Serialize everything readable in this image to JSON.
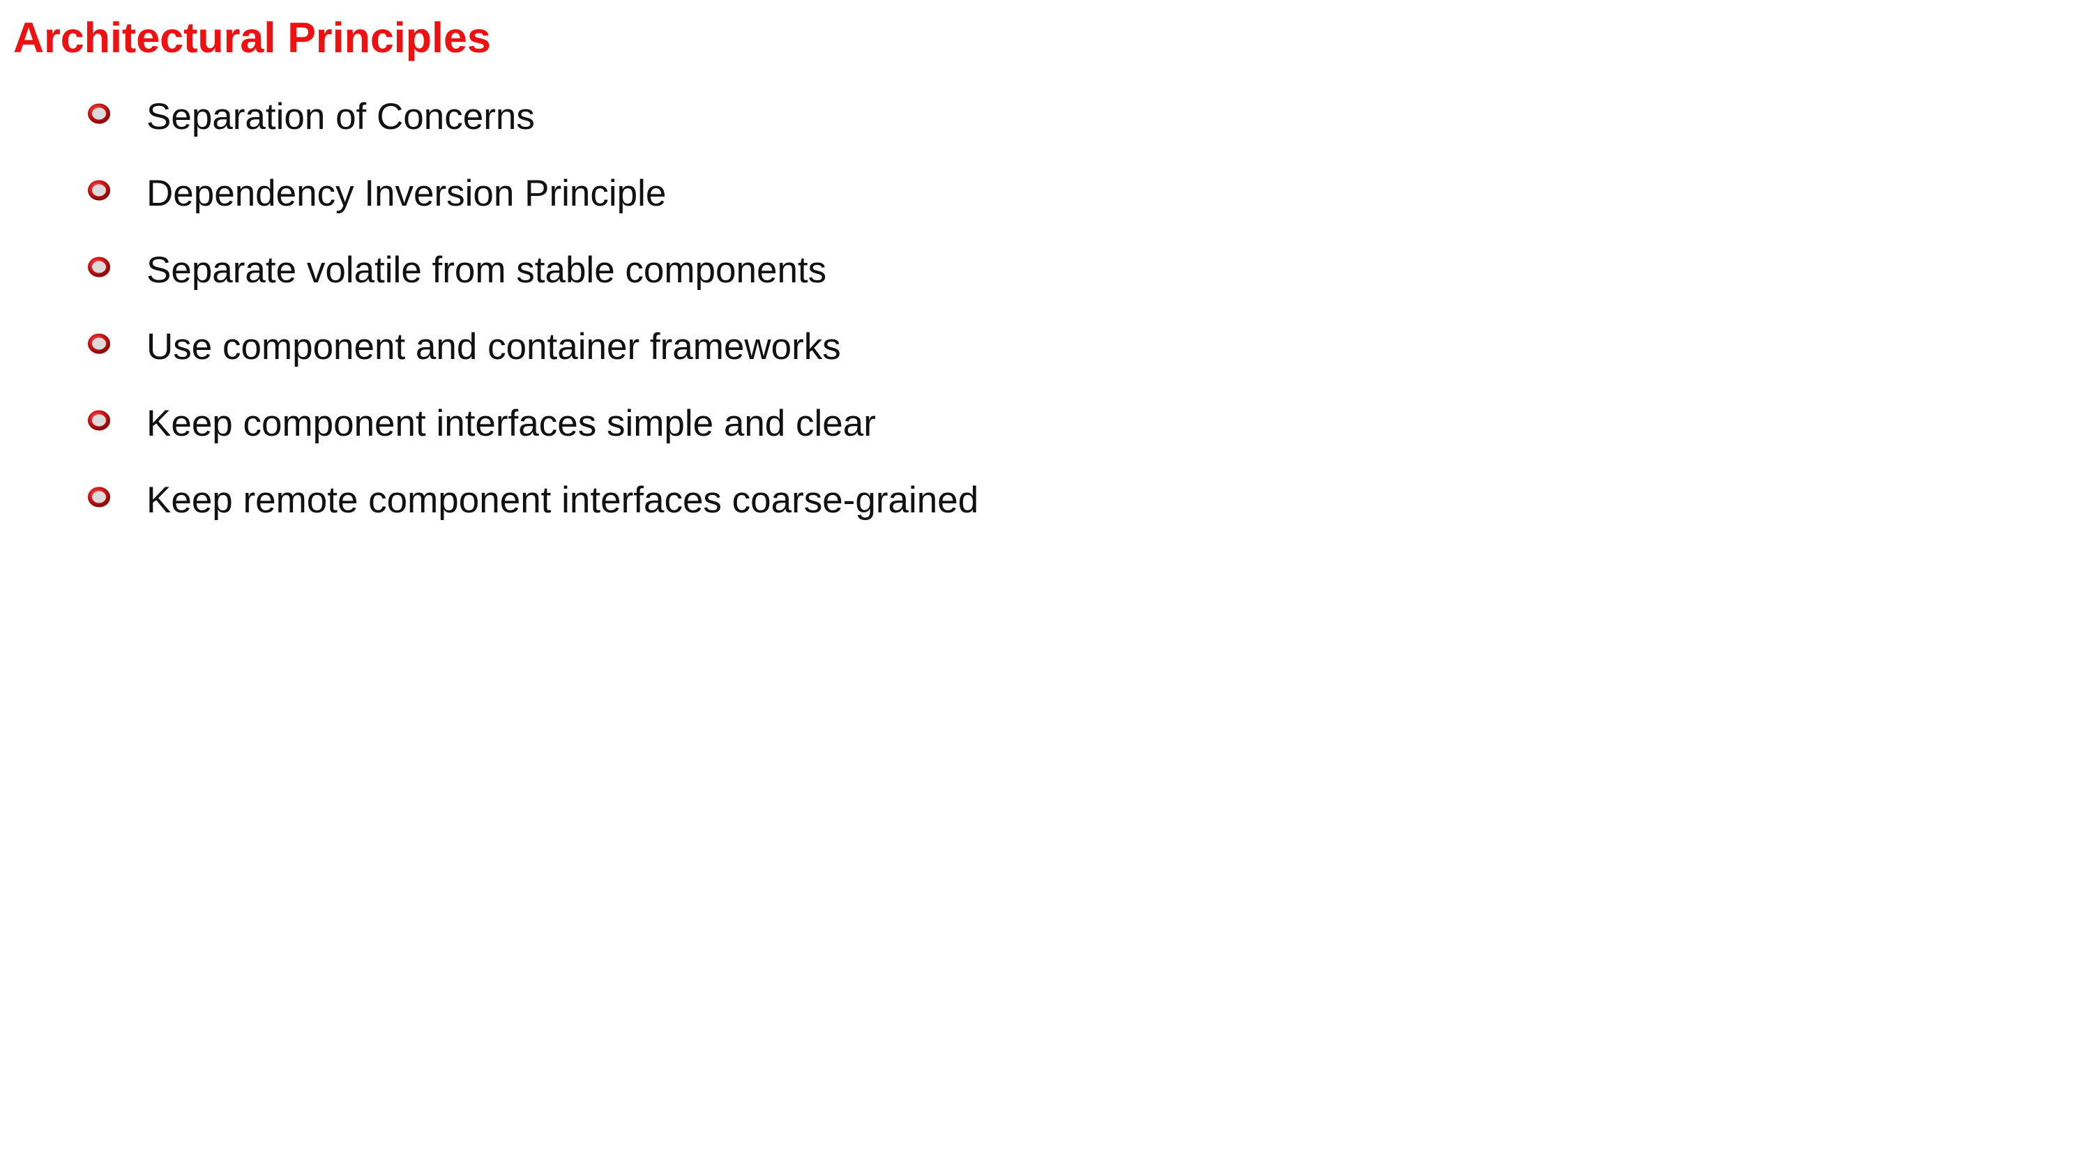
{
  "slide": {
    "title": "Architectural Principles",
    "title_color": "#EE1111",
    "bullet_icon": "red-ring-bullet-icon",
    "bullet_color": "#CC1111",
    "bullets": [
      {
        "label": "Separation of Concerns"
      },
      {
        "label": "Dependency Inversion Principle"
      },
      {
        "label": "Separate volatile from stable components"
      },
      {
        "label": "Use component and container frameworks"
      },
      {
        "label": "Keep component interfaces simple and clear"
      },
      {
        "label": "Keep remote component interfaces coarse-grained"
      }
    ]
  }
}
